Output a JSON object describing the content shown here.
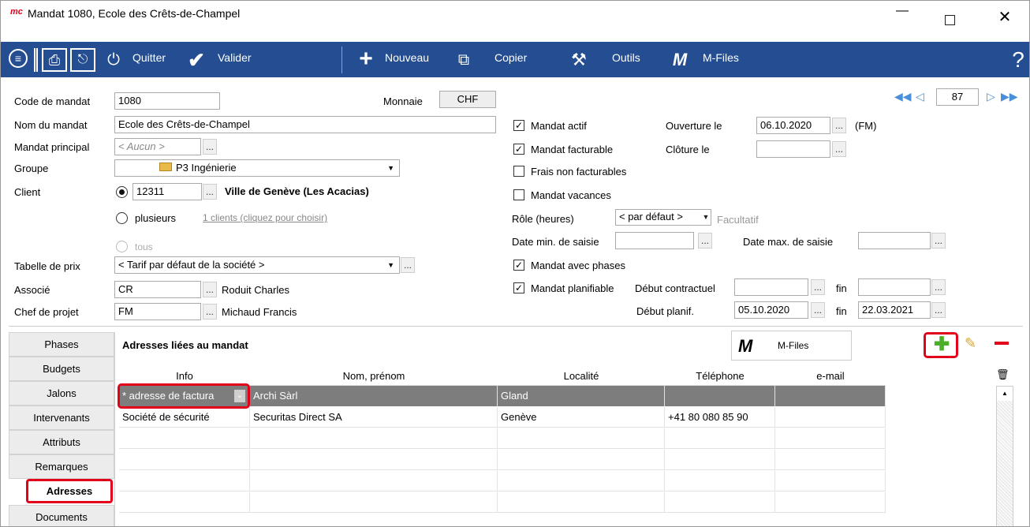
{
  "window": {
    "app_icon": "mc-logo-icon",
    "title": "Mandat 1080, Ecole des Crêts-de-Champel",
    "controls": [
      "minimize-icon",
      "maximize-icon",
      "close-icon"
    ]
  },
  "toolbar": {
    "quit_label": "Quitter",
    "validate_label": "Valider",
    "new_label": "Nouveau",
    "copy_label": "Copier",
    "tools_label": "Outils",
    "mfiles_label": "M-Files",
    "help_symbol": "?"
  },
  "nav": {
    "record_number": "87"
  },
  "form": {
    "code_label": "Code de mandat",
    "code_value": "1080",
    "currency_label": "Monnaie",
    "currency_value": "CHF",
    "name_label": "Nom du mandat",
    "name_value": "Ecole des Crêts-de-Champel",
    "principal_label": "Mandat principal",
    "principal_value": "< Aucun >",
    "group_label": "Groupe",
    "group_value": "P3 Ingénierie",
    "client_label": "Client",
    "client_code": "12311",
    "client_name": "Ville de Genève  (Les Acacias)",
    "several_label": "plusieurs",
    "several_link": "1 clients (cliquez pour choisir)",
    "all_label": "tous",
    "price_label": "Tabelle de prix",
    "price_value": "< Tarif par défaut de la société >",
    "partner_label": "Associé",
    "partner_code": "CR",
    "partner_name": "Roduit Charles",
    "pm_label": "Chef de projet",
    "pm_code": "FM",
    "pm_name": "Michaud Francis"
  },
  "options": {
    "active_label": "Mandat actif",
    "active_checked": true,
    "billable_label": "Mandat facturable",
    "billable_checked": true,
    "nonbill_label": "Frais non facturables",
    "nonbill_checked": false,
    "holiday_label": "Mandat vacances",
    "holiday_checked": false,
    "opening_label": "Ouverture le",
    "opening_value": "06.10.2020",
    "opening_by": "(FM)",
    "closing_label": "Clôture le",
    "closing_value": "",
    "role_label": "Rôle (heures)",
    "role_value": "< par défaut >",
    "role_hint": "Facultatif",
    "datemin_label": "Date min. de saisie",
    "datemax_label": "Date max. de saisie",
    "phases_label": "Mandat avec phases",
    "phases_checked": true,
    "plan_label": "Mandat planifiable",
    "plan_checked": true,
    "contract_start_label": "Début contractuel",
    "end_label": "fin",
    "plan_start_label": "Début planif.",
    "plan_start_value": "05.10.2020",
    "plan_end_value": "22.03.2021"
  },
  "tabs": [
    "Phases",
    "Budgets",
    "Jalons",
    "Intervenants",
    "Attributs",
    "Remarques",
    "Adresses",
    "Documents"
  ],
  "active_tab": "Adresses",
  "addresses": {
    "title": "Adresses liées au mandat",
    "mfiles_label": "M-Files",
    "columns": [
      "Info",
      "Nom, prénom",
      "Localité",
      "Téléphone",
      "e-mail"
    ],
    "rows": [
      {
        "info": "* adresse de factura",
        "name": "Archi Sàrl",
        "city": "Gland",
        "phone": "",
        "email": ""
      },
      {
        "info": "Société de sécurité",
        "name": "Securitas Direct SA",
        "city": "Genève",
        "phone": "+41 80 080 85 90",
        "email": ""
      }
    ]
  },
  "colors": {
    "toolbar": "#244e91",
    "highlight": "#e2001a",
    "selected_row": "#7d7d7d",
    "nav_arrow": "#4a8fd9"
  }
}
